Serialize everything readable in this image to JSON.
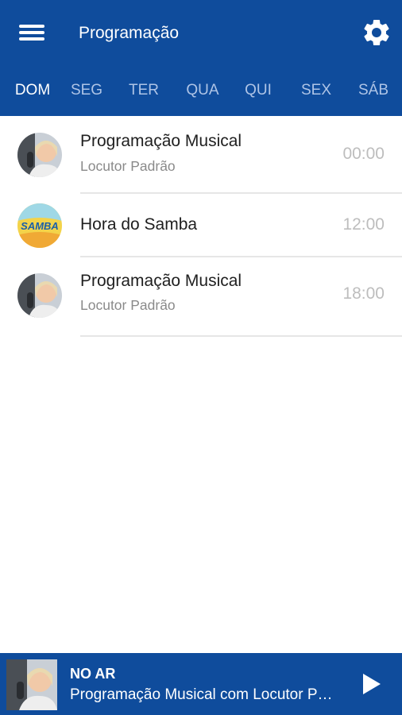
{
  "header": {
    "title": "Programação",
    "menu_icon": "hamburger-menu-icon",
    "settings_icon": "gear-icon",
    "background_color": "#0f4c9c"
  },
  "tabs": [
    {
      "label": "DOM",
      "active": true
    },
    {
      "label": "SEG",
      "active": false
    },
    {
      "label": "TER",
      "active": false
    },
    {
      "label": "QUA",
      "active": false
    },
    {
      "label": "QUI",
      "active": false
    },
    {
      "label": "SEX",
      "active": false
    },
    {
      "label": "SÁB",
      "active": false
    }
  ],
  "schedule": [
    {
      "title": "Programação Musical",
      "host": "Locutor Padrão",
      "time": "00:00",
      "avatar": "host-photo"
    },
    {
      "title": "Hora do Samba",
      "host": "",
      "time": "12:00",
      "avatar": "samba-logo"
    },
    {
      "title": "Programação Musical",
      "host": "Locutor Padrão",
      "time": "18:00",
      "avatar": "host-photo"
    }
  ],
  "player": {
    "label": "NO AR",
    "now_playing": "Programação Musical com Locutor Padrão",
    "play_icon": "play-icon"
  }
}
